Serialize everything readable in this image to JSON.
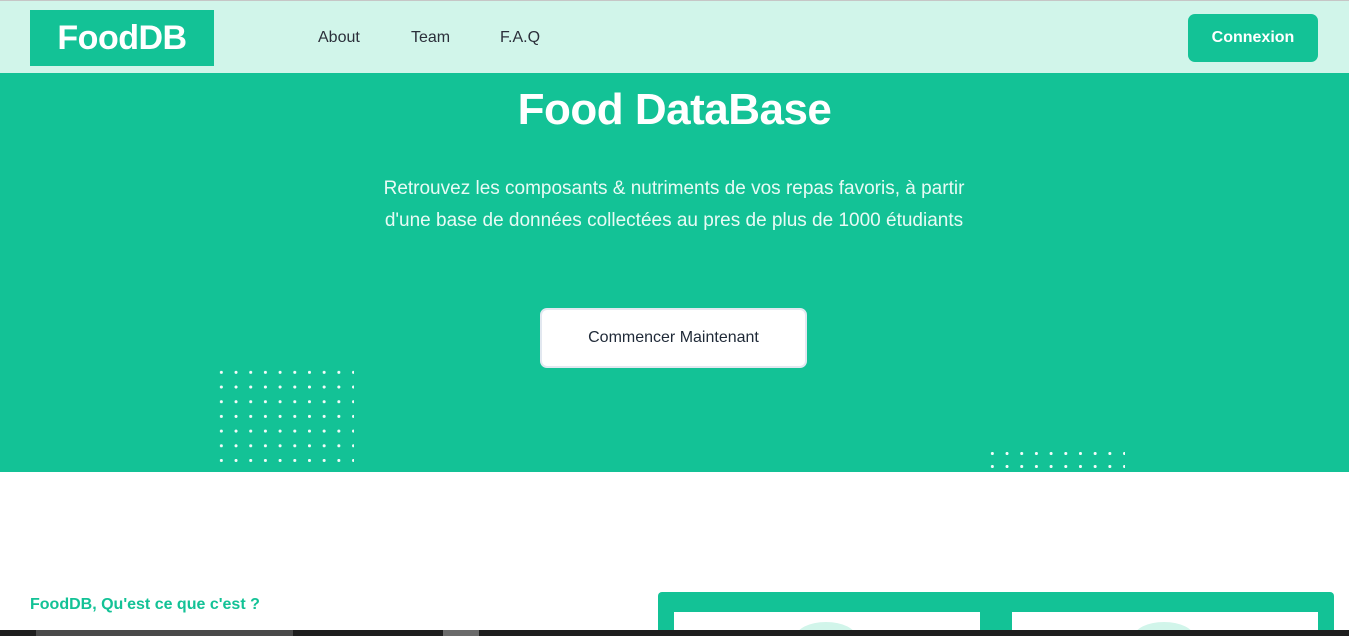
{
  "navbar": {
    "logo": "FoodDB",
    "links": [
      "About",
      "Team",
      "F.A.Q"
    ],
    "login_label": "Connexion"
  },
  "hero": {
    "title": "Food DataBase",
    "text": "Retrouvez les composants & nutriments de vos repas favoris, à partir d'une base de données collectées au pres de plus de 1000 étudiants",
    "cta_label": "Commencer Maintenant"
  },
  "about": {
    "heading": "FoodDB, Qu'est ce que c'est ?"
  },
  "colors": {
    "brand": "#13c296",
    "navbar_bg": "#d1f5ea",
    "white": "#ffffff"
  }
}
